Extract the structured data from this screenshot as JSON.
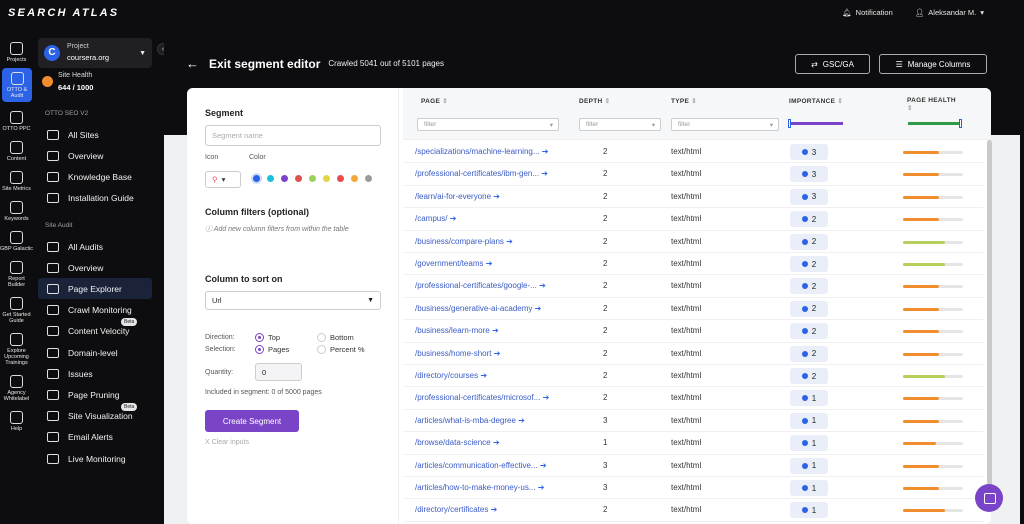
{
  "brand": "SEARCH ATLAS",
  "topbar": {
    "notification": "Notification",
    "user": "Aleksandar M."
  },
  "rail": [
    {
      "label": "Projects"
    },
    {
      "label": "OTTO & Audit"
    },
    {
      "label": "OTTO PPC"
    },
    {
      "label": "Content"
    },
    {
      "label": "Site Metrics"
    },
    {
      "label": "Keywords"
    },
    {
      "label": "GBP Galactic"
    },
    {
      "label": "Report Builder"
    },
    {
      "label": "Get Started Guide"
    },
    {
      "label": "Explore Upcoming Trainings"
    },
    {
      "label": "Agency Whitelabel"
    },
    {
      "label": "Help"
    }
  ],
  "project": {
    "label": "Project",
    "name": "coursera.org"
  },
  "health": {
    "label": "Site Health",
    "value": "644 / 1000"
  },
  "sidebar": {
    "section1": "OTTO SEO V2",
    "items1": [
      {
        "label": "All Sites"
      },
      {
        "label": "Overview"
      },
      {
        "label": "Knowledge Base"
      },
      {
        "label": "Installation Guide"
      }
    ],
    "section2": "Site Audit",
    "items2": [
      {
        "label": "All Audits"
      },
      {
        "label": "Overview"
      },
      {
        "label": "Page Explorer"
      },
      {
        "label": "Crawl Monitoring"
      },
      {
        "label": "Content Velocity"
      },
      {
        "label": "Domain-level"
      },
      {
        "label": "Issues"
      },
      {
        "label": "Page Pruning"
      },
      {
        "label": "Site Visualization"
      },
      {
        "label": "Email Alerts"
      },
      {
        "label": "Live Monitoring"
      }
    ],
    "beta": "Beta"
  },
  "header": {
    "back": "←",
    "title": "Exit segment editor",
    "subtitle": "Crawled 5041 out of 5101 pages",
    "gsc": "GSC/GA",
    "manage": "Manage Columns"
  },
  "segment": {
    "heading": "Segment",
    "name_placeholder": "Segment name",
    "icon_label": "Icon",
    "color_label": "Color",
    "colors": [
      "#2c63e6",
      "#1ec0d8",
      "#7a44c9",
      "#e0524f",
      "#9ad25b",
      "#e3d54a",
      "#ea4b4b",
      "#f2a93a",
      "#9a9a9a"
    ],
    "filters_heading": "Column filters (optional)",
    "filters_hint": "Add new column filters from within the table",
    "sort_heading": "Column to sort on",
    "sort_value": "Url",
    "direction_label": "Direction:",
    "selection_label": "Selection:",
    "top": "Top",
    "bottom": "Bottom",
    "pages": "Pages",
    "percent": "Percent %",
    "quantity_label": "Quantity:",
    "quantity_value": "0",
    "included": "Included in segment: 0 of 5000 pages",
    "create": "Create Segment",
    "clear": "X Clear inputs"
  },
  "table": {
    "headers": [
      "PAGE",
      "DEPTH",
      "TYPE",
      "IMPORTANCE",
      "PAGE HEALTH"
    ],
    "filter_placeholder": "filter",
    "rows": [
      {
        "page": "/specializations/machine-learning...",
        "depth": "2",
        "type": "text/html",
        "importance": "3",
        "health": 0.6,
        "hc": "#f08d2f"
      },
      {
        "page": "/professional-certificates/ibm-gen...",
        "depth": "2",
        "type": "text/html",
        "importance": "3",
        "health": 0.6,
        "hc": "#f08d2f"
      },
      {
        "page": "/learn/ai-for-everyone",
        "depth": "2",
        "type": "text/html",
        "importance": "3",
        "health": 0.6,
        "hc": "#f08d2f"
      },
      {
        "page": "/campus/",
        "depth": "2",
        "type": "text/html",
        "importance": "2",
        "health": 0.6,
        "hc": "#f08d2f"
      },
      {
        "page": "/business/compare-plans",
        "depth": "2",
        "type": "text/html",
        "importance": "2",
        "health": 0.7,
        "hc": "#b6d05b"
      },
      {
        "page": "/government/teams",
        "depth": "2",
        "type": "text/html",
        "importance": "2",
        "health": 0.7,
        "hc": "#b6d05b"
      },
      {
        "page": "/professional-certificates/google-...",
        "depth": "2",
        "type": "text/html",
        "importance": "2",
        "health": 0.6,
        "hc": "#f08d2f"
      },
      {
        "page": "/business/generative-ai-academy",
        "depth": "2",
        "type": "text/html",
        "importance": "2",
        "health": 0.6,
        "hc": "#f08d2f"
      },
      {
        "page": "/business/learn-more",
        "depth": "2",
        "type": "text/html",
        "importance": "2",
        "health": 0.6,
        "hc": "#f08d2f"
      },
      {
        "page": "/business/home-short",
        "depth": "2",
        "type": "text/html",
        "importance": "2",
        "health": 0.6,
        "hc": "#f08d2f"
      },
      {
        "page": "/directory/courses",
        "depth": "2",
        "type": "text/html",
        "importance": "2",
        "health": 0.7,
        "hc": "#b6d05b"
      },
      {
        "page": "/professional-certificates/microsof...",
        "depth": "2",
        "type": "text/html",
        "importance": "1",
        "health": 0.6,
        "hc": "#f08d2f"
      },
      {
        "page": "/articles/what-is-mba-degree",
        "depth": "3",
        "type": "text/html",
        "importance": "1",
        "health": 0.6,
        "hc": "#f08d2f"
      },
      {
        "page": "/browse/data-science",
        "depth": "1",
        "type": "text/html",
        "importance": "1",
        "health": 0.55,
        "hc": "#f08d2f"
      },
      {
        "page": "/articles/communication-effective...",
        "depth": "3",
        "type": "text/html",
        "importance": "1",
        "health": 0.6,
        "hc": "#f08d2f"
      },
      {
        "page": "/articles/how-to-make-money-us...",
        "depth": "3",
        "type": "text/html",
        "importance": "1",
        "health": 0.6,
        "hc": "#f08d2f"
      },
      {
        "page": "/directory/certificates",
        "depth": "2",
        "type": "text/html",
        "importance": "1",
        "health": 0.7,
        "hc": "#f08d2f"
      }
    ]
  }
}
